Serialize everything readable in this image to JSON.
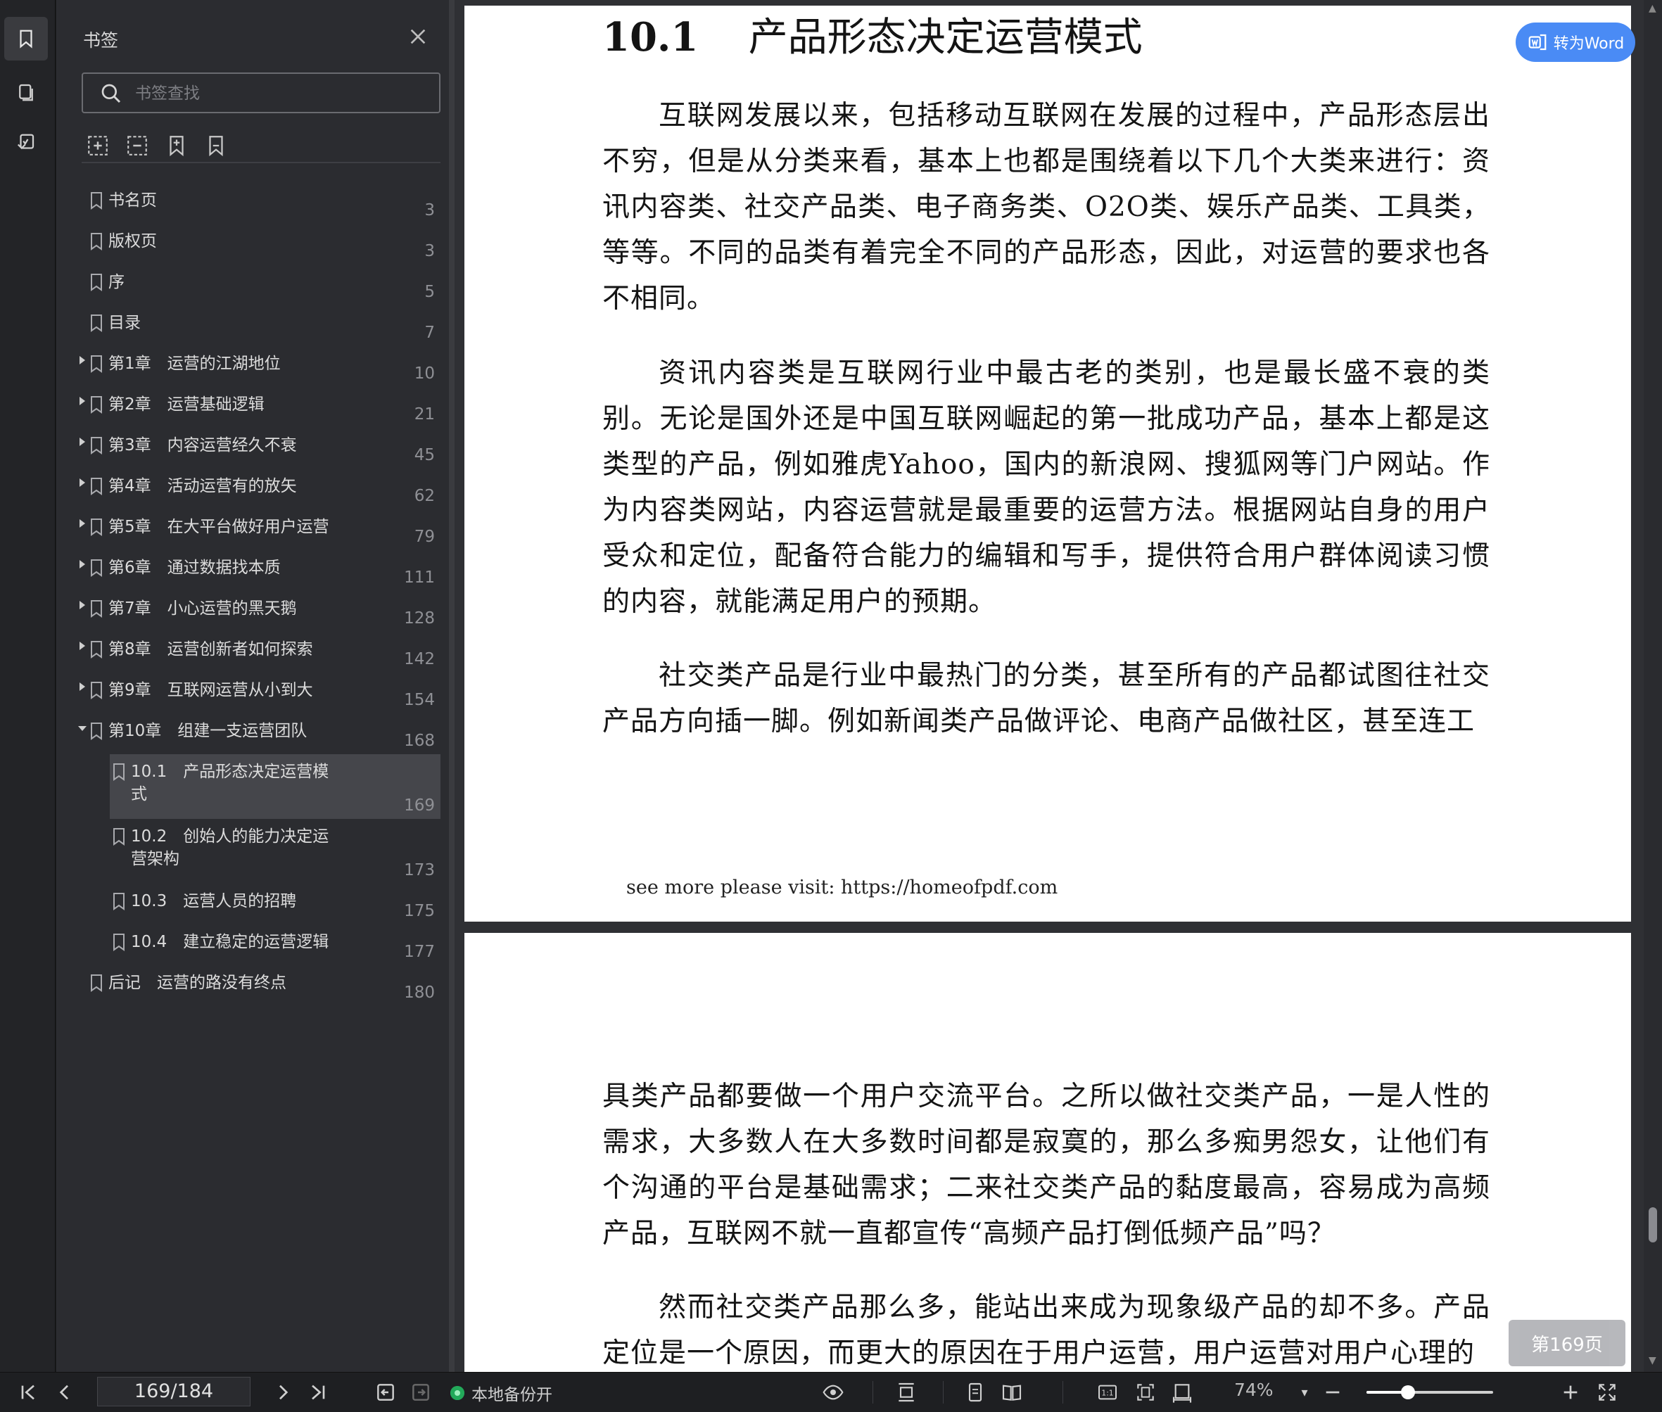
{
  "sidebar": {
    "title": "书签",
    "search_placeholder": "书签查找",
    "tools": [
      "expand-all-icon",
      "collapse-all-icon",
      "add-bookmark-icon",
      "bookmark-icon"
    ],
    "items": [
      {
        "label": "书名页",
        "page": "3"
      },
      {
        "label": "版权页",
        "page": "3"
      },
      {
        "label": "序",
        "page": "5"
      },
      {
        "label": "目录",
        "page": "7"
      },
      {
        "label": "第1章　运营的江湖地位",
        "page": "10"
      },
      {
        "label": "第2章　运营基础逻辑",
        "page": "21"
      },
      {
        "label": "第3章　内容运营经久不衰",
        "page": "45"
      },
      {
        "label": "第4章　活动运营有的放矢",
        "page": "62"
      },
      {
        "label": "第5章　在大平台做好用户运营",
        "page": "79"
      },
      {
        "label": "第6章　通过数据找本质",
        "page": "111"
      },
      {
        "label": "第7章　小心运营的黑天鹅",
        "page": "128"
      },
      {
        "label": "第8章　运营创新者如何探索",
        "page": "142"
      },
      {
        "label": "第9章　互联网运营从小到大",
        "page": "154"
      },
      {
        "label": "第10章　组建一支运营团队",
        "page": "168"
      },
      {
        "label": "10.1　产品形态决定运营模式",
        "page": "169"
      },
      {
        "label": "10.2　创始人的能力决定运营架构",
        "page": "173"
      },
      {
        "label": "10.3　运营人员的招聘",
        "page": "175"
      },
      {
        "label": "10.4　建立稳定的运营逻辑",
        "page": "177"
      },
      {
        "label": "后记　运营的路没有终点",
        "page": "180"
      }
    ]
  },
  "document": {
    "heading_num": "10.1",
    "heading_title": "产品形态决定运营模式",
    "p1": "互联网发展以来，包括移动互联网在发展的过程中，产品形态层出不穷，但是从分类来看，基本上也都是围绕着以下几个大类来进行：资讯内容类、社交产品类、电子商务类、O2O类、娱乐产品类、工具类，等等。不同的品类有着完全不同的产品形态，因此，对运营的要求也各不相同。",
    "p2": "资讯内容类是互联网行业中最古老的类别，也是最长盛不衰的类别。无论是国外还是中国互联网崛起的第一批成功产品，基本上都是这类型的产品，例如雅虎Yahoo，国内的新浪网、搜狐网等门户网站。作为内容类网站，内容运营就是最重要的运营方法。根据网站自身的用户受众和定位，配备符合能力的编辑和写手，提供符合用户群体阅读习惯的内容，就能满足用户的预期。",
    "p3": "社交类产品是行业中最热门的分类，甚至所有的产品都试图往社交产品方向插一脚。例如新闻类产品做评论、电商产品做社区，甚至连工",
    "footer": "see more please visit: https://homeofpdf.com",
    "p4": "具类产品都要做一个用户交流平台。之所以做社交类产品，一是人性的需求，大多数人在大多数时间都是寂寞的，那么多痴男怨女，让他们有个沟通的平台是基础需求；二来社交类产品的黏度最高，容易成为高频产品，互联网不就一直都宣传“高频产品打倒低频产品”吗？",
    "p5": "然而社交类产品那么多，能站出来成为现象级产品的却不多。产品定位是一个原因，而更大的原因在于用户运营，用户运营对用户心理的"
  },
  "convert_button": "转为Word",
  "page_chip": "第169页",
  "statusbar": {
    "page_indicator": "169/184",
    "backup_label": "本地备份开",
    "zoom": "74%",
    "zoom_fraction": 0.33
  },
  "colors": {
    "accent": "#4a8bf5",
    "backup_on": "#23a95a"
  }
}
